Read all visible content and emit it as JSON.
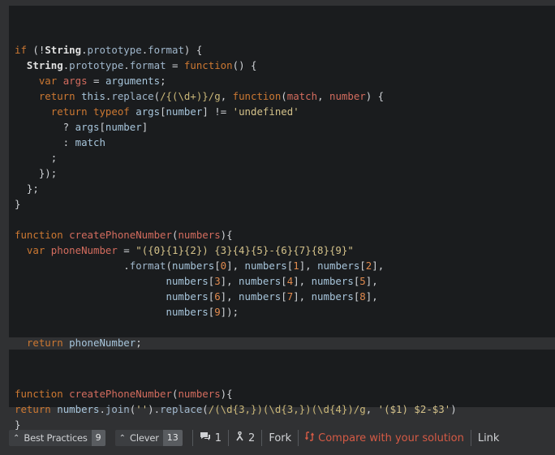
{
  "solution_1_lines": [
    [
      [
        "k",
        "if"
      ],
      [
        "p",
        " (!"
      ],
      [
        "b",
        "String"
      ],
      [
        "p",
        "."
      ],
      [
        "ptxt",
        "prototype"
      ],
      [
        "p",
        "."
      ],
      [
        "ptxt",
        "format"
      ],
      [
        "p",
        ") {"
      ]
    ],
    [
      [
        "p",
        "  "
      ],
      [
        "b",
        "String"
      ],
      [
        "p",
        "."
      ],
      [
        "ptxt",
        "prototype"
      ],
      [
        "p",
        "."
      ],
      [
        "ptxt",
        "format"
      ],
      [
        "p",
        " = "
      ],
      [
        "k",
        "function"
      ],
      [
        "p",
        "() {"
      ]
    ],
    [
      [
        "p",
        "    "
      ],
      [
        "k",
        "var"
      ],
      [
        "p",
        " "
      ],
      [
        "f",
        "args"
      ],
      [
        "p",
        " = "
      ],
      [
        "v",
        "arguments"
      ],
      [
        "p",
        ";"
      ]
    ],
    [
      [
        "p",
        "    "
      ],
      [
        "k",
        "return"
      ],
      [
        "p",
        " "
      ],
      [
        "v",
        "this"
      ],
      [
        "p",
        "."
      ],
      [
        "ptxt",
        "replace"
      ],
      [
        "p",
        "("
      ],
      [
        "r",
        "/{(\\d+)}/g"
      ],
      [
        "p",
        ", "
      ],
      [
        "k",
        "function"
      ],
      [
        "p",
        "("
      ],
      [
        "f",
        "match"
      ],
      [
        "p",
        ", "
      ],
      [
        "f",
        "number"
      ],
      [
        "p",
        ") {"
      ]
    ],
    [
      [
        "p",
        "      "
      ],
      [
        "k",
        "return"
      ],
      [
        "p",
        " "
      ],
      [
        "k",
        "typeof"
      ],
      [
        "p",
        " "
      ],
      [
        "v",
        "args"
      ],
      [
        "p",
        "["
      ],
      [
        "v",
        "number"
      ],
      [
        "p",
        "] != "
      ],
      [
        "s",
        "'undefined'"
      ]
    ],
    [
      [
        "p",
        "        ? "
      ],
      [
        "v",
        "args"
      ],
      [
        "p",
        "["
      ],
      [
        "v",
        "number"
      ],
      [
        "p",
        "]"
      ]
    ],
    [
      [
        "p",
        "        : "
      ],
      [
        "v",
        "match"
      ]
    ],
    [
      [
        "p",
        "      ;"
      ]
    ],
    [
      [
        "p",
        "    });"
      ]
    ],
    [
      [
        "p",
        "  };"
      ]
    ],
    [
      [
        "p",
        "}"
      ]
    ],
    [
      [
        "p",
        ""
      ]
    ],
    [
      [
        "k",
        "function"
      ],
      [
        "p",
        " "
      ],
      [
        "f",
        "createPhoneNumber"
      ],
      [
        "p",
        "("
      ],
      [
        "f",
        "numbers"
      ],
      [
        "p",
        "){"
      ]
    ],
    [
      [
        "p",
        "  "
      ],
      [
        "k",
        "var"
      ],
      [
        "p",
        " "
      ],
      [
        "f",
        "phoneNumber"
      ],
      [
        "p",
        " = "
      ],
      [
        "s",
        "\"({0}{1}{2}) {3}{4}{5}-{6}{7}{8}{9}\""
      ]
    ],
    [
      [
        "p",
        "                  ."
      ],
      [
        "ptxt",
        "format"
      ],
      [
        "p",
        "("
      ],
      [
        "v",
        "numbers"
      ],
      [
        "p",
        "["
      ],
      [
        "n",
        "0"
      ],
      [
        "p",
        "], "
      ],
      [
        "v",
        "numbers"
      ],
      [
        "p",
        "["
      ],
      [
        "n",
        "1"
      ],
      [
        "p",
        "], "
      ],
      [
        "v",
        "numbers"
      ],
      [
        "p",
        "["
      ],
      [
        "n",
        "2"
      ],
      [
        "p",
        "],"
      ]
    ],
    [
      [
        "p",
        "                         "
      ],
      [
        "v",
        "numbers"
      ],
      [
        "p",
        "["
      ],
      [
        "n",
        "3"
      ],
      [
        "p",
        "], "
      ],
      [
        "v",
        "numbers"
      ],
      [
        "p",
        "["
      ],
      [
        "n",
        "4"
      ],
      [
        "p",
        "], "
      ],
      [
        "v",
        "numbers"
      ],
      [
        "p",
        "["
      ],
      [
        "n",
        "5"
      ],
      [
        "p",
        "],"
      ]
    ],
    [
      [
        "p",
        "                         "
      ],
      [
        "v",
        "numbers"
      ],
      [
        "p",
        "["
      ],
      [
        "n",
        "6"
      ],
      [
        "p",
        "], "
      ],
      [
        "v",
        "numbers"
      ],
      [
        "p",
        "["
      ],
      [
        "n",
        "7"
      ],
      [
        "p",
        "], "
      ],
      [
        "v",
        "numbers"
      ],
      [
        "p",
        "["
      ],
      [
        "n",
        "8"
      ],
      [
        "p",
        "],"
      ]
    ],
    [
      [
        "p",
        "                         "
      ],
      [
        "v",
        "numbers"
      ],
      [
        "p",
        "["
      ],
      [
        "n",
        "9"
      ],
      [
        "p",
        "]);"
      ]
    ],
    [
      [
        "p",
        ""
      ]
    ],
    [
      [
        "p",
        "  "
      ],
      [
        "k",
        "return"
      ],
      [
        "p",
        " "
      ],
      [
        "v",
        "phoneNumber"
      ],
      [
        "p",
        ";"
      ]
    ],
    [
      [
        "p",
        "}"
      ]
    ]
  ],
  "solution_2_lines": [
    [
      [
        "k",
        "function"
      ],
      [
        "p",
        " "
      ],
      [
        "f",
        "createPhoneNumber"
      ],
      [
        "p",
        "("
      ],
      [
        "f",
        "numbers"
      ],
      [
        "p",
        "){"
      ]
    ],
    [
      [
        "k",
        "return"
      ],
      [
        "p",
        " "
      ],
      [
        "v",
        "numbers"
      ],
      [
        "p",
        "."
      ],
      [
        "ptxt",
        "join"
      ],
      [
        "p",
        "("
      ],
      [
        "s",
        "''"
      ],
      [
        "p",
        ")."
      ],
      [
        "ptxt",
        "replace"
      ],
      [
        "p",
        "("
      ],
      [
        "r",
        "/(\\d{3,})(\\d{3,})(\\d{4})/g"
      ],
      [
        "p",
        ", "
      ],
      [
        "s",
        "'($1) $2-$3'"
      ],
      [
        "p",
        ")"
      ]
    ],
    [
      [
        "p",
        "}"
      ]
    ]
  ],
  "colors": {
    "keyword": "#cc7832",
    "function_name": "#d36c5e",
    "string": "#d4c28a",
    "number": "#e08a4e",
    "compare_link": "#d55a45",
    "code_background": "#1a1c1e",
    "page_background": "#303133"
  },
  "footer": {
    "best_practices_label": "Best Practices",
    "best_practices_count": "9",
    "clever_label": "Clever",
    "clever_count": "13",
    "comments_icon": "comments-icon",
    "comments_count": "1",
    "forks_icon": "fork-icon",
    "forks_count": "2",
    "fork_label": "Fork",
    "compare_icon": "compare-icon",
    "compare_label": "Compare with your solution",
    "link_label": "Link"
  }
}
